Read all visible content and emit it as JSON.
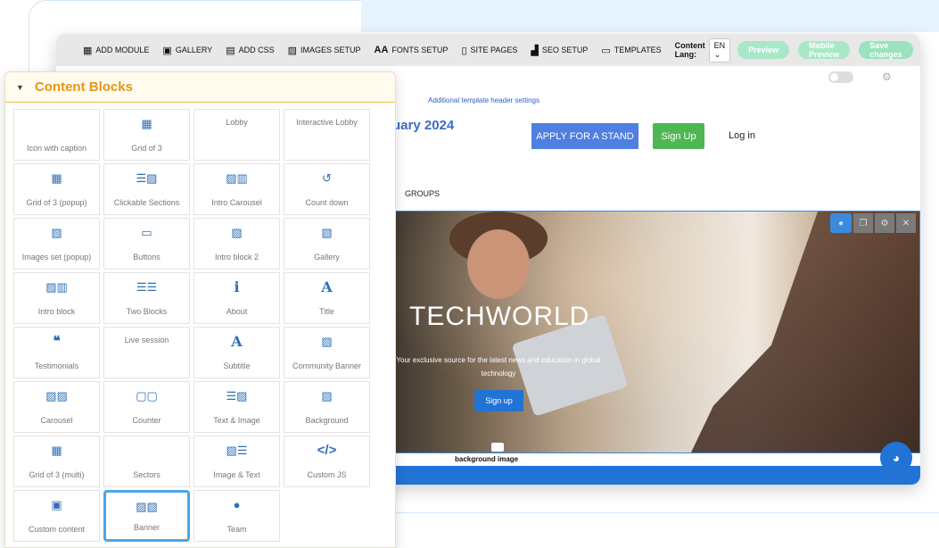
{
  "toolbar": {
    "items": [
      {
        "label": "ADD MODULE",
        "icon": "grid-icon",
        "glyph": "▦"
      },
      {
        "label": "GALLERY",
        "icon": "gallery-icon",
        "glyph": "▣"
      },
      {
        "label": "ADD CSS",
        "icon": "css-icon",
        "glyph": "▤"
      },
      {
        "label": "IMAGES SETUP",
        "icon": "image-icon",
        "glyph": "▨"
      },
      {
        "label": "FONTS SETUP",
        "icon": "fonts-icon",
        "glyph": "Aa"
      },
      {
        "label": "SITE PAGES",
        "icon": "page-icon",
        "glyph": "▯"
      },
      {
        "label": "SEO SETUP",
        "icon": "chart-icon",
        "glyph": "▟"
      },
      {
        "label": "TEMPLATES",
        "icon": "templates-icon",
        "glyph": "▭"
      }
    ],
    "content_lang_label": "Content Lang:",
    "content_lang_value": "EN",
    "preview": "Preview",
    "mobile_preview": "Mobile Preview",
    "save_changes": "Save changes"
  },
  "page": {
    "header_settings_link": "Additional template header settings",
    "event_title": "uary 2024",
    "apply_button": "APPLY FOR A STAND",
    "signup_button": "Sign Up",
    "login_link": "Log in",
    "nav_groups": "GROUPS",
    "hero_title": "TECHWORLD",
    "hero_subtitle": "Your exclusive source for the latest news and education in global technology",
    "hero_button": "Sign up",
    "background_caption": "background image"
  },
  "content_blocks": {
    "title": "Content Blocks",
    "selected": "Banner",
    "items": [
      {
        "label": "Icon with caption",
        "icon": ""
      },
      {
        "label": "Grid of 3",
        "icon": "grid-icon"
      },
      {
        "label": "Lobby",
        "icon": ""
      },
      {
        "label": "Interactive Lobby",
        "icon": ""
      },
      {
        "label": "Grid of 3 (popup)",
        "icon": "grid-icon"
      },
      {
        "label": "Clickable Sections",
        "icon": "text-image-icon"
      },
      {
        "label": "Intro Carousel",
        "icon": "image-film-icon"
      },
      {
        "label": "Count down",
        "icon": "history-icon"
      },
      {
        "label": "Images set (popup)",
        "icon": "image-icon"
      },
      {
        "label": "Buttons",
        "icon": "button-icon"
      },
      {
        "label": "Intro block 2",
        "icon": "image-icon"
      },
      {
        "label": "Gallery",
        "icon": "image-icon"
      },
      {
        "label": "Intro block",
        "icon": "image-film-icon"
      },
      {
        "label": "Two Blocks",
        "icon": "two-columns-icon"
      },
      {
        "label": "About",
        "icon": "info-icon"
      },
      {
        "label": "Title",
        "icon": "letter-a-icon"
      },
      {
        "label": "Testimonials",
        "icon": "quote-icon"
      },
      {
        "label": "Live session",
        "icon": ""
      },
      {
        "label": "Subtitle",
        "icon": "letter-a-icon"
      },
      {
        "label": "Community Banner",
        "icon": "image-icon"
      },
      {
        "label": "Carousel",
        "icon": "double-image-icon"
      },
      {
        "label": "Counter",
        "icon": "counter-icon"
      },
      {
        "label": "Text & Image",
        "icon": "text-image-icon"
      },
      {
        "label": "Background",
        "icon": "image-icon"
      },
      {
        "label": "Grid of 3 (multi)",
        "icon": "grid-icon"
      },
      {
        "label": "Sectors",
        "icon": ""
      },
      {
        "label": "Image & Text",
        "icon": "image-text-icon"
      },
      {
        "label": "Custom JS",
        "icon": "code-icon"
      },
      {
        "label": "Custom content",
        "icon": "custom-content-icon"
      },
      {
        "label": "Banner",
        "icon": "double-image-icon"
      },
      {
        "label": "Team",
        "icon": "person-icon"
      }
    ]
  }
}
